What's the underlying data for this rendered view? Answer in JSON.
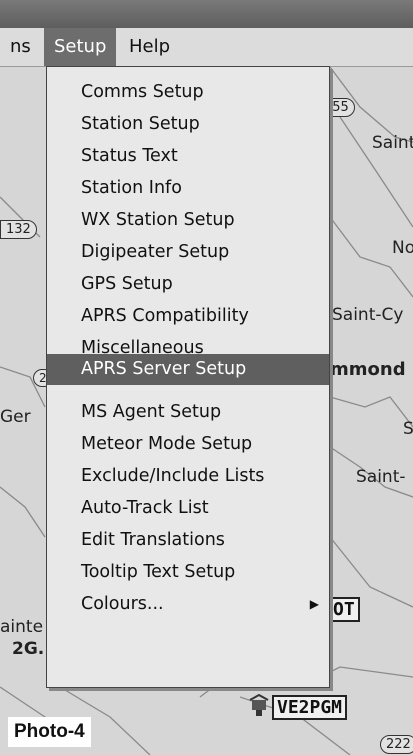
{
  "menubar": {
    "items": [
      {
        "label": "ns",
        "active": false
      },
      {
        "label": "Setup",
        "active": true
      },
      {
        "label": "Help",
        "active": false
      }
    ]
  },
  "setup_menu": {
    "items": [
      {
        "label": "Comms Setup"
      },
      {
        "label": "Station Setup"
      },
      {
        "label": "Status Text"
      },
      {
        "label": "Station Info"
      },
      {
        "label": "WX Station Setup"
      },
      {
        "label": "Digipeater Setup"
      },
      {
        "label": "GPS Setup"
      },
      {
        "label": "APRS Compatibility"
      },
      {
        "label": "Miscellaneous"
      },
      {
        "label": "APRS Server Setup",
        "highlighted": true
      },
      {
        "label": "MS Agent Setup"
      },
      {
        "label": "Meteor Mode Setup"
      },
      {
        "label": "Exclude/Include Lists"
      },
      {
        "label": "Auto-Track List"
      },
      {
        "label": "Edit Translations"
      },
      {
        "label": "Tooltip Text Setup"
      },
      {
        "label": "Colours...",
        "has_submenu": true,
        "submenu_arrow": "▶"
      }
    ]
  },
  "map": {
    "places": [
      {
        "text": "Saint"
      },
      {
        "text": "No"
      },
      {
        "text": "Saint-Cy"
      },
      {
        "text": "mmond"
      },
      {
        "text": "S"
      },
      {
        "text": "Saint-"
      },
      {
        "text": "Ger"
      },
      {
        "text": "ainte"
      },
      {
        "text": "2G..."
      }
    ],
    "shields": [
      {
        "text": "155"
      },
      {
        "text": "132"
      },
      {
        "text": "2"
      },
      {
        "text": "222"
      }
    ],
    "callsigns": [
      {
        "text": "OT"
      },
      {
        "text": "VE2PGM"
      }
    ]
  },
  "caption": "Photo-4"
}
